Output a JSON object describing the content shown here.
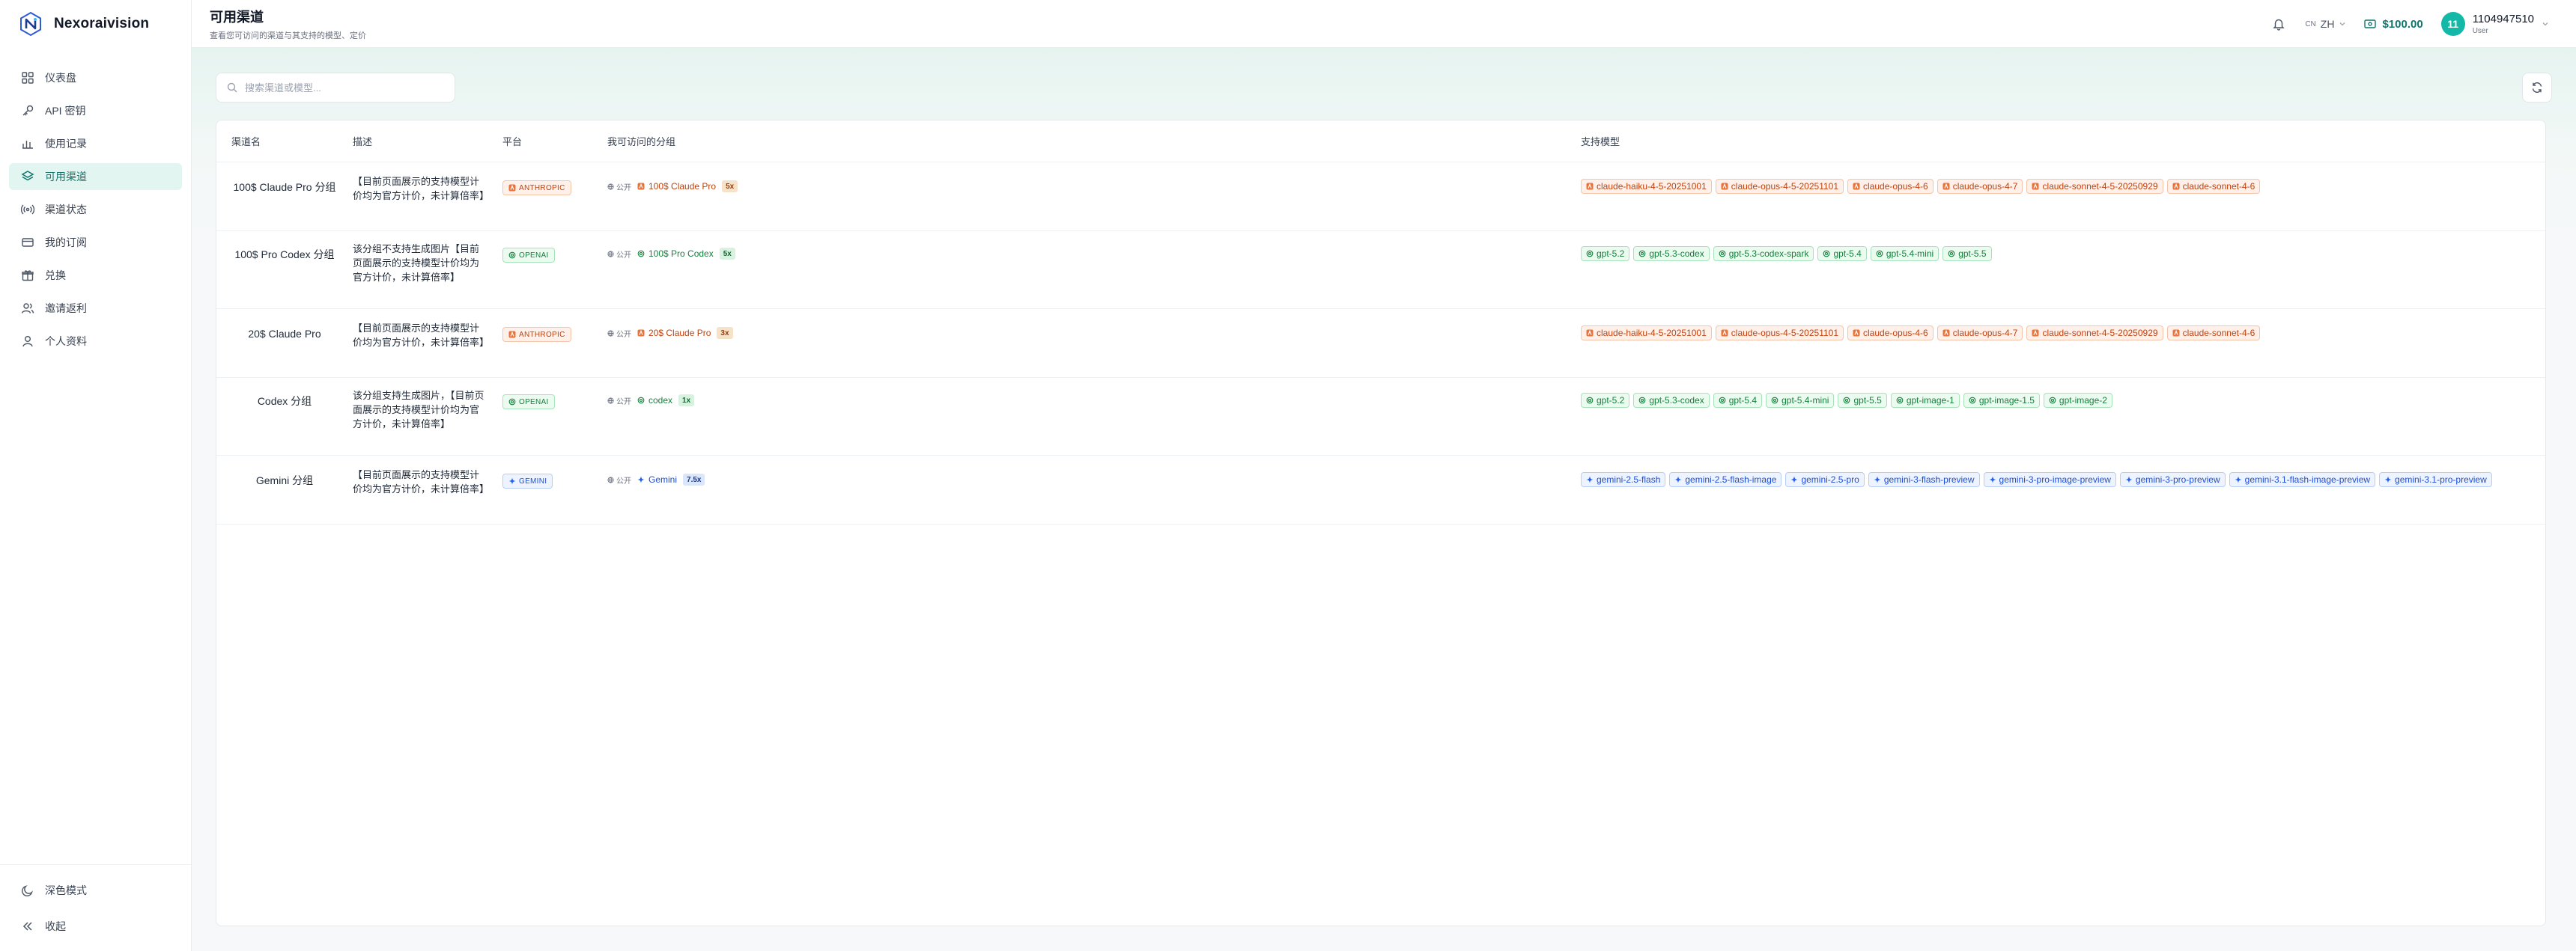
{
  "brand": {
    "name": "Nexoraivision"
  },
  "sidebar": {
    "items": [
      {
        "label": "仪表盘"
      },
      {
        "label": "API 密钥"
      },
      {
        "label": "使用记录"
      },
      {
        "label": "可用渠道"
      },
      {
        "label": "渠道状态"
      },
      {
        "label": "我的订阅"
      },
      {
        "label": "兑换"
      },
      {
        "label": "邀请返利"
      },
      {
        "label": "个人资料"
      }
    ],
    "bottom": [
      {
        "label": "深色模式"
      },
      {
        "label": "收起"
      }
    ]
  },
  "header": {
    "title": "可用渠道",
    "subtitle": "查看您可访问的渠道与其支持的模型、定价",
    "lang_prefix": "CN",
    "lang": "ZH",
    "balance": "$100.00",
    "avatar": "11",
    "user_id": "1104947510",
    "user_role": "User"
  },
  "search": {
    "placeholder": "搜索渠道或模型..."
  },
  "table": {
    "columns": [
      "渠道名",
      "描述",
      "平台",
      "我可访问的分组",
      "支持模型"
    ],
    "public_label": "公开",
    "rows": [
      {
        "name": "100$ Claude Pro 分组",
        "desc": "【目前页面展示的支持模型计价均为官方计价，未计算倍率】",
        "platform": "ANTHROPIC",
        "kind": "anth",
        "group": "100$ Claude Pro",
        "rate": "5x",
        "models": [
          "claude-haiku-4-5-20251001",
          "claude-opus-4-5-20251101",
          "claude-opus-4-6",
          "claude-opus-4-7",
          "claude-sonnet-4-5-20250929",
          "claude-sonnet-4-6"
        ]
      },
      {
        "name": "100$ Pro Codex 分组",
        "desc": "该分组不支持生成图片【目前页面展示的支持模型计价均为官方计价，未计算倍率】",
        "platform": "OPENAI",
        "kind": "oai",
        "group": "100$ Pro Codex",
        "rate": "5x",
        "models": [
          "gpt-5.2",
          "gpt-5.3-codex",
          "gpt-5.3-codex-spark",
          "gpt-5.4",
          "gpt-5.4-mini",
          "gpt-5.5"
        ]
      },
      {
        "name": "20$ Claude Pro",
        "desc": "【目前页面展示的支持模型计价均为官方计价，未计算倍率】",
        "platform": "ANTHROPIC",
        "kind": "anth",
        "group": "20$ Claude Pro",
        "rate": "3x",
        "models": [
          "claude-haiku-4-5-20251001",
          "claude-opus-4-5-20251101",
          "claude-opus-4-6",
          "claude-opus-4-7",
          "claude-sonnet-4-5-20250929",
          "claude-sonnet-4-6"
        ]
      },
      {
        "name": "Codex 分组",
        "desc": "该分组支持生成图片，【目前页面展示的支持模型计价均为官方计价，未计算倍率】",
        "platform": "OPENAI",
        "kind": "oai",
        "group": "codex",
        "rate": "1x",
        "models": [
          "gpt-5.2",
          "gpt-5.3-codex",
          "gpt-5.4",
          "gpt-5.4-mini",
          "gpt-5.5",
          "gpt-image-1",
          "gpt-image-1.5",
          "gpt-image-2"
        ]
      },
      {
        "name": "Gemini 分组",
        "desc": "【目前页面展示的支持模型计价均为官方计价，未计算倍率】",
        "platform": "GEMINI",
        "kind": "gem",
        "group": "Gemini",
        "rate": "7.5x",
        "models": [
          "gemini-2.5-flash",
          "gemini-2.5-flash-image",
          "gemini-2.5-pro",
          "gemini-3-flash-preview",
          "gemini-3-pro-image-preview",
          "gemini-3-pro-preview",
          "gemini-3.1-flash-image-preview",
          "gemini-3.1-pro-preview"
        ]
      }
    ]
  },
  "colors": {
    "accent": "#0f766e",
    "anthropic": "#c2410c",
    "openai": "#15803d",
    "gemini": "#1d4ed8"
  }
}
